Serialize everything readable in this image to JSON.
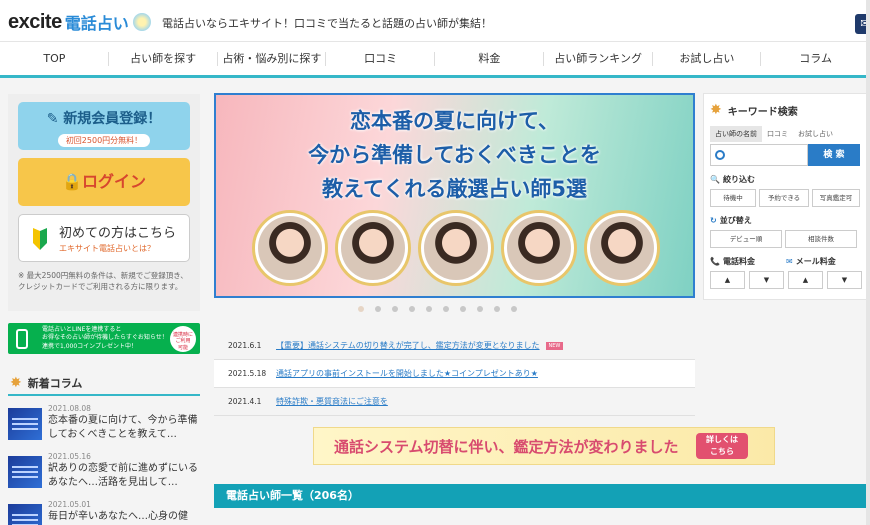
{
  "header": {
    "logo_excite": "excite",
    "logo_service": "電話占い",
    "tagline": "電話占いならエキサイト！口コミで当たると話題の占い師が集結！"
  },
  "nav": [
    "TOP",
    "占い師を探す",
    "占術・悩み別に探す",
    "口コミ",
    "料金",
    "占い師ランキング",
    "お試し占い",
    "コラム"
  ],
  "left": {
    "register_label": "新規会員登録！",
    "register_sub": "初回2500円分無料！",
    "login_label": "ログイン",
    "first_label": "初めての方はこちら",
    "first_sub": "エキサイト電話占いとは？",
    "note": "※ 最大2500円無料の条件は、新規でご登録頂き、クレジットカードでご利用される方に限ります。",
    "line_banner_text": "電話占いとLINEを連携すると\nお得なその占い師が待機したらすぐお知らせ！\n連携で1,000コインプレゼント中！",
    "line_badge": "連携時に\nご利用\n可能"
  },
  "columns": {
    "heading": "新着コラム",
    "items": [
      {
        "date": "2021.08.08",
        "title": "恋本番の夏に向けて、今から準備しておくべきことを教えて…"
      },
      {
        "date": "2021.05.16",
        "title": "訳ありの恋愛で前に進めずにいるあなたへ…活路を見出して…"
      },
      {
        "date": "2021.05.01",
        "title": "毎日が辛いあなたへ…心身の健"
      }
    ]
  },
  "banner": {
    "line1": "恋本番の夏に向けて、",
    "line2": "今から準備しておくべきことを",
    "line3": "教えてくれる厳選占い師5選"
  },
  "news": [
    {
      "date": "2021.6.1",
      "title": "【重要】通話システムの切り替えが完了し、鑑定方法が変更となりました",
      "badge": "NEW"
    },
    {
      "date": "2021.5.18",
      "title": "通話アプリの事前インストールを開始しました★コインプレゼントあり★",
      "badge": ""
    },
    {
      "date": "2021.4.1",
      "title": "特殊詐欺・悪質商法にご注意を",
      "badge": ""
    }
  ],
  "system_banner": {
    "text": "通話システム切替に伴い、鑑定方法が変わりました",
    "more": "詳しくは\nこちら"
  },
  "list_bar": "電話占い師一覧（206名）",
  "keyword": {
    "heading": "キーワード検索",
    "tabs": [
      "占い師の名前",
      "口コミ",
      "お試し占い"
    ],
    "search_button": "検 索",
    "search_placeholder": "",
    "narrow_label": "絞り込む",
    "narrow_chips": [
      "待機中",
      "予約できる",
      "写真鑑定可"
    ],
    "sort_label": "並び替え",
    "sort_chips": [
      "デビュー順",
      "相談件数"
    ],
    "phone_fee_label": "電話料金",
    "mail_fee_label": "メール料金",
    "arrows": [
      "▲",
      "▼",
      "▲",
      "▼"
    ]
  },
  "colors": {
    "accent": "#35b7c8",
    "link": "#2a7cc7",
    "login": "#f7c64a",
    "register": "#8fd3ec"
  }
}
